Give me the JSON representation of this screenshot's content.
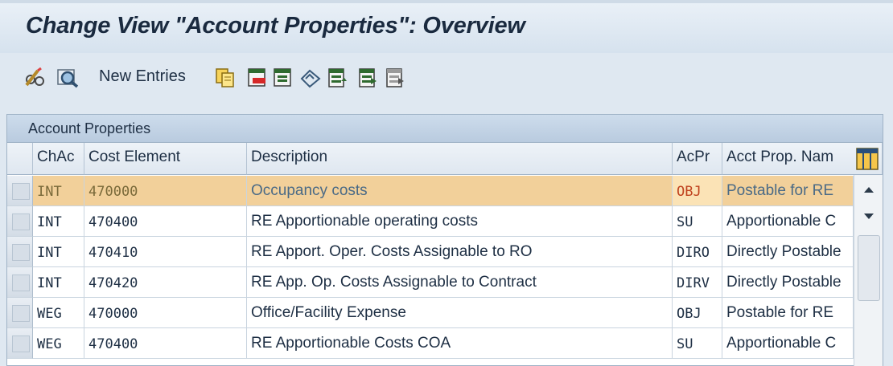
{
  "window": {
    "title": "Change View \"Account Properties\": Overview"
  },
  "toolbar": {
    "change_display_icon": "glasses-pencil-icon",
    "details_icon": "magnifier-details-icon",
    "new_entries_label": "New Entries",
    "buttons": [
      "copy-as-icon",
      "delete-icon",
      "undo-change-icon",
      "select-all-icon",
      "select-block-icon",
      "deselect-all-icon"
    ]
  },
  "panel": {
    "title": "Account Properties",
    "columns": {
      "chac": "ChAc",
      "cost_element": "Cost Element",
      "description": "Description",
      "acpr": "AcPr",
      "acct_prop_name": "Acct Prop. Nam"
    },
    "rows": [
      {
        "chac": "INT",
        "cost_element": "470000",
        "description": "Occupancy costs",
        "acpr": "OBJ",
        "acct_prop_name": "Postable for RE",
        "selected": true
      },
      {
        "chac": "INT",
        "cost_element": "470400",
        "description": "RE Apportionable operating costs",
        "acpr": "SU",
        "acct_prop_name": "Apportionable C"
      },
      {
        "chac": "INT",
        "cost_element": "470410",
        "description": "RE Apport. Oper. Costs Assignable to RO",
        "acpr": "DIRO",
        "acct_prop_name": "Directly Postable"
      },
      {
        "chac": "INT",
        "cost_element": "470420",
        "description": "RE App. Op. Costs Assignable to Contract",
        "acpr": "DIRV",
        "acct_prop_name": "Directly Postable"
      },
      {
        "chac": "WEG",
        "cost_element": "470000",
        "description": "Office/Facility Expense",
        "acpr": "OBJ",
        "acct_prop_name": "Postable for RE"
      },
      {
        "chac": "WEG",
        "cost_element": "470400",
        "description": "RE Apportionable Costs COA",
        "acpr": "SU",
        "acct_prop_name": "Apportionable C"
      }
    ]
  },
  "colors": {
    "selected_row": "#f2d09a",
    "header_blue": "#b9cbdf",
    "acpr_selected_text": "#c0421e"
  }
}
